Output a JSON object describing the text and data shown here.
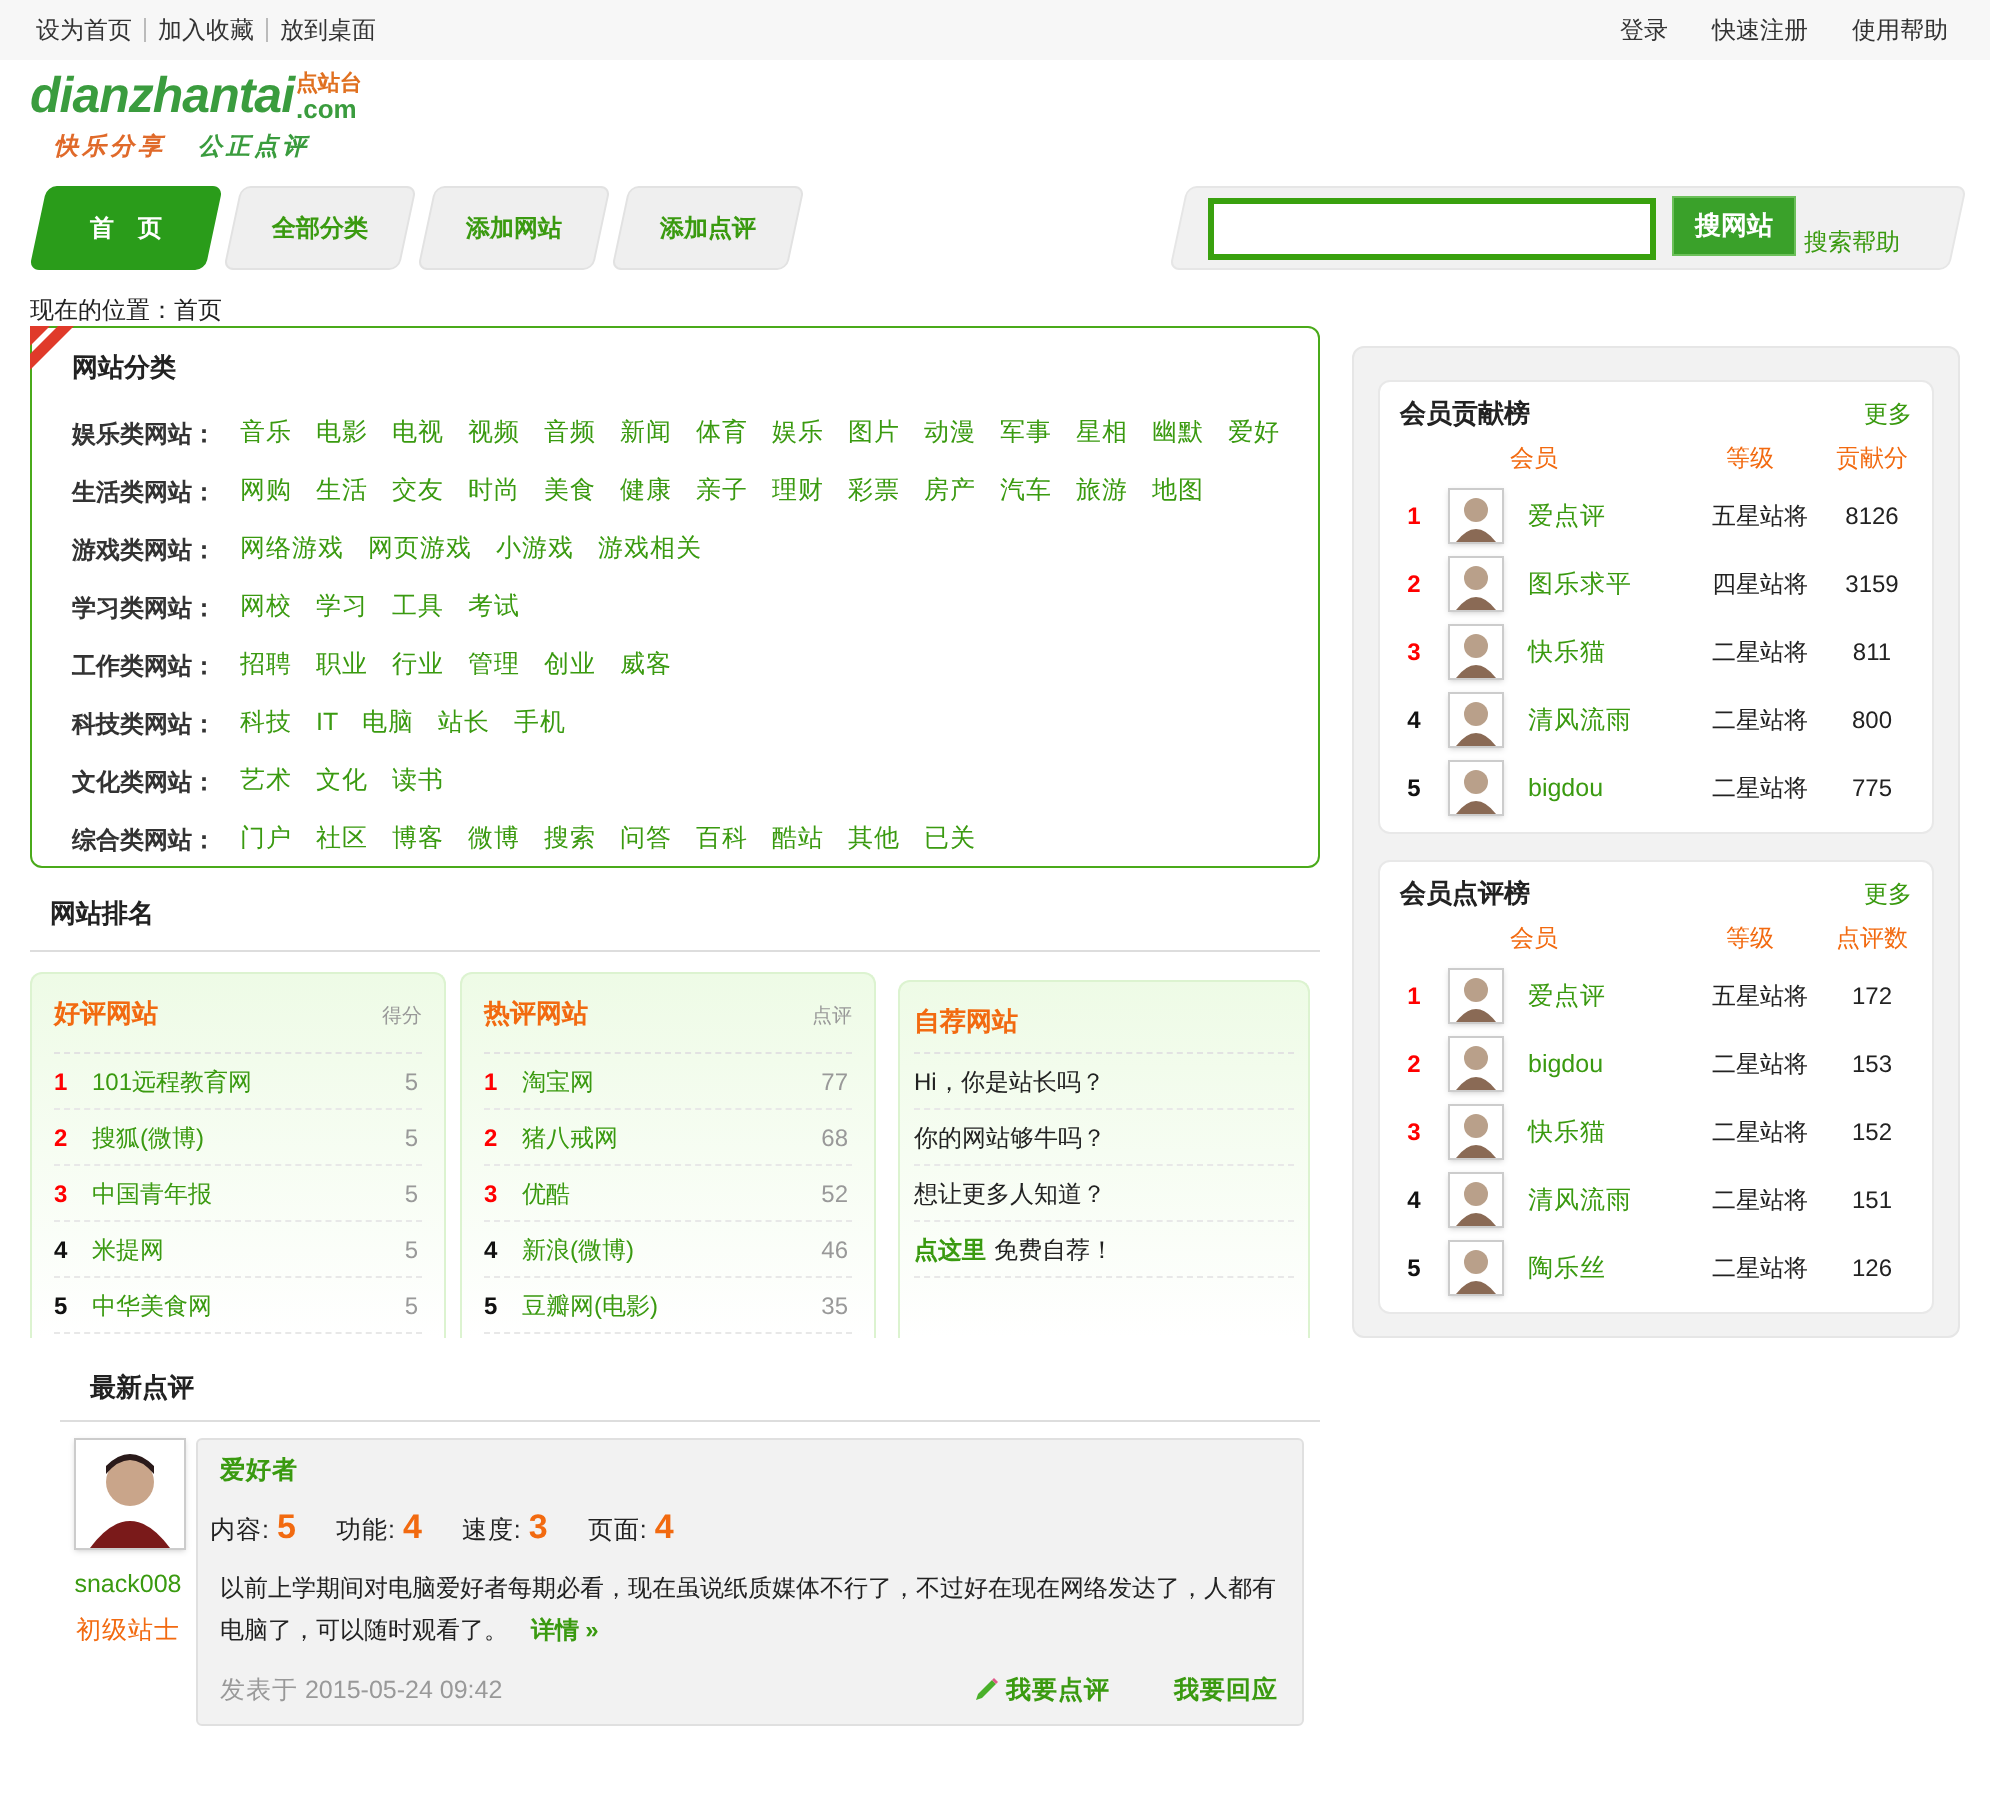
{
  "top_bar": {
    "left_links": [
      "设为首页",
      "加入收藏",
      "放到桌面"
    ],
    "right_links": [
      "登录",
      "快速注册",
      "使用帮助"
    ]
  },
  "logo": {
    "name": "dianzhantai",
    "suffix": ".com",
    "cn_name": "点站台",
    "slogans": [
      "快乐分享",
      "公正点评"
    ]
  },
  "nav_tabs": [
    {
      "label": "首　页",
      "selected": true
    },
    {
      "label": "全部分类",
      "selected": false
    },
    {
      "label": "添加网站",
      "selected": false
    },
    {
      "label": "添加点评",
      "selected": false
    }
  ],
  "search": {
    "button": "搜网站",
    "help": "搜索帮助"
  },
  "breadcrumb": "现在的位置：首页",
  "categories": {
    "title": "网站分类",
    "groups": [
      {
        "label": "娱乐类网站：",
        "links": [
          "音乐",
          "电影",
          "电视",
          "视频",
          "音频",
          "新闻",
          "体育",
          "娱乐",
          "图片",
          "动漫",
          "军事",
          "星相",
          "幽默",
          "爱好"
        ]
      },
      {
        "label": "生活类网站：",
        "links": [
          "网购",
          "生活",
          "交友",
          "时尚",
          "美食",
          "健康",
          "亲子",
          "理财",
          "彩票",
          "房产",
          "汽车",
          "旅游",
          "地图"
        ]
      },
      {
        "label": "游戏类网站：",
        "links": [
          "网络游戏",
          "网页游戏",
          "小游戏",
          "游戏相关"
        ]
      },
      {
        "label": "学习类网站：",
        "links": [
          "网校",
          "学习",
          "工具",
          "考试"
        ]
      },
      {
        "label": "工作类网站：",
        "links": [
          "招聘",
          "职业",
          "行业",
          "管理",
          "创业",
          "威客"
        ]
      },
      {
        "label": "科技类网站：",
        "links": [
          "科技",
          "IT",
          "电脑",
          "站长",
          "手机"
        ]
      },
      {
        "label": "文化类网站：",
        "links": [
          "艺术",
          "文化",
          "读书"
        ]
      },
      {
        "label": "综合类网站：",
        "links": [
          "门户",
          "社区",
          "博客",
          "微博",
          "搜索",
          "问答",
          "百科",
          "酷站",
          "其他",
          "已关"
        ]
      }
    ]
  },
  "ranking": {
    "title": "网站排名",
    "boards": [
      {
        "title": "好评网站",
        "column": "得分",
        "rows": [
          {
            "rank": "1",
            "name": "101远程教育网",
            "value": "5"
          },
          {
            "rank": "2",
            "name": "搜狐(微博)",
            "value": "5"
          },
          {
            "rank": "3",
            "name": "中国青年报",
            "value": "5"
          },
          {
            "rank": "4",
            "name": "米提网",
            "value": "5"
          },
          {
            "rank": "5",
            "name": "中华美食网",
            "value": "5"
          }
        ]
      },
      {
        "title": "热评网站",
        "column": "点评",
        "rows": [
          {
            "rank": "1",
            "name": "淘宝网",
            "value": "77"
          },
          {
            "rank": "2",
            "name": "猪八戒网",
            "value": "68"
          },
          {
            "rank": "3",
            "name": "优酷",
            "value": "52"
          },
          {
            "rank": "4",
            "name": "新浪(微博)",
            "value": "46"
          },
          {
            "rank": "5",
            "name": "豆瓣网(电影)",
            "value": "35"
          }
        ]
      }
    ],
    "self_recommend": {
      "title": "自荐网站",
      "lines": [
        "Hi，你是站长吗？",
        "你的网站够牛吗？",
        "想让更多人知道？"
      ],
      "cta_link": "点这里",
      "cta_text": "免费自荐！"
    }
  },
  "latest_reviews": {
    "title": "最新点评",
    "items": [
      {
        "user": "snack008",
        "user_level": "初级站士",
        "site": "爱好者",
        "scores": [
          {
            "label": "内容:",
            "value": "5"
          },
          {
            "label": "功能:",
            "value": "4"
          },
          {
            "label": "速度:",
            "value": "3"
          },
          {
            "label": "页面:",
            "value": "4"
          }
        ],
        "text": "以前上学期间对电脑爱好者每期必看，现在虽说纸质媒体不行了，不过好在现在网络发达了，人都有电脑了，可以随时观看了。",
        "more": "详情 »",
        "posted": "发表于 2015-05-24 09:42",
        "actions": [
          "我要点评",
          "我要回应"
        ]
      }
    ]
  },
  "member_boards": [
    {
      "title": "会员贡献榜",
      "more": "更多",
      "columns": [
        "会员",
        "等级",
        "贡献分"
      ],
      "rows": [
        {
          "rank": "1",
          "name": "爱点评",
          "level": "五星站将",
          "value": "8126"
        },
        {
          "rank": "2",
          "name": "图乐求平",
          "level": "四星站将",
          "value": "3159"
        },
        {
          "rank": "3",
          "name": "快乐猫",
          "level": "二星站将",
          "value": "811"
        },
        {
          "rank": "4",
          "name": "清风流雨",
          "level": "二星站将",
          "value": "800"
        },
        {
          "rank": "5",
          "name": "bigdou",
          "level": "二星站将",
          "value": "775"
        }
      ]
    },
    {
      "title": "会员点评榜",
      "more": "更多",
      "columns": [
        "会员",
        "等级",
        "点评数"
      ],
      "rows": [
        {
          "rank": "1",
          "name": "爱点评",
          "level": "五星站将",
          "value": "172"
        },
        {
          "rank": "2",
          "name": "bigdou",
          "level": "二星站将",
          "value": "153"
        },
        {
          "rank": "3",
          "name": "快乐猫",
          "level": "二星站将",
          "value": "152"
        },
        {
          "rank": "4",
          "name": "清风流雨",
          "level": "二星站将",
          "value": "151"
        },
        {
          "rank": "5",
          "name": "陶乐丝",
          "level": "二星站将",
          "value": "126"
        }
      ]
    }
  ]
}
